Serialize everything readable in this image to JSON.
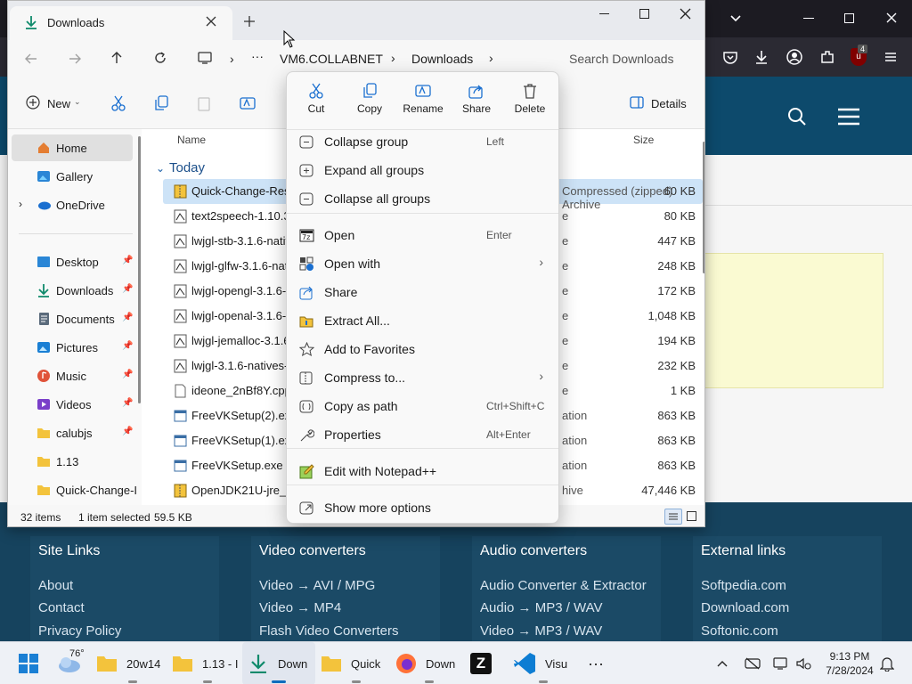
{
  "firefox": {
    "extension_badge": "4"
  },
  "site": {
    "footer": [
      {
        "heading": "Site Links",
        "links": [
          "About",
          "Contact",
          "Privacy Policy"
        ]
      },
      {
        "heading": "Video converters",
        "links": [
          "Video → AVI / MPG",
          "Video → MP4",
          "Flash Video Converters"
        ]
      },
      {
        "heading": "Audio converters",
        "links": [
          "Audio Converter & Extractor",
          "Audio → MP3 / WAV",
          "Video → MP3 / WAV"
        ]
      },
      {
        "heading": "External links",
        "links": [
          "Softpedia.com",
          "Download.com",
          "Softonic.com"
        ]
      }
    ]
  },
  "explorer": {
    "tab_title": "Downloads",
    "breadcrumb": [
      "VM6.COLLABNET",
      "Downloads"
    ],
    "search_placeholder": "Search Downloads",
    "toolbar": {
      "new_label": "New",
      "details_label": "Details"
    },
    "nav": {
      "home": "Home",
      "gallery": "Gallery",
      "onedrive": "OneDrive",
      "pinned": [
        "Desktop",
        "Downloads",
        "Documents",
        "Pictures",
        "Music",
        "Videos",
        "calubjs",
        "1.13",
        "Quick-Change-I"
      ]
    },
    "columns": {
      "name": "Name",
      "size": "Size"
    },
    "group": "Today",
    "files": [
      {
        "name": "Quick-Change-Resolu",
        "type": "Compressed (zipped) Archive",
        "size": "60 KB"
      },
      {
        "name": "text2speech-1.10.3-na",
        "type": "e",
        "size": "80 KB"
      },
      {
        "name": "lwjgl-stb-3.1.6-natives",
        "type": "e",
        "size": "447 KB"
      },
      {
        "name": "lwjgl-glfw-3.1.6-nativ",
        "type": "e",
        "size": "248 KB"
      },
      {
        "name": "lwjgl-opengl-3.1.6-na",
        "type": "e",
        "size": "172 KB"
      },
      {
        "name": "lwjgl-openal-3.1.6-nat",
        "type": "e",
        "size": "1,048 KB"
      },
      {
        "name": "lwjgl-jemalloc-3.1.6-n",
        "type": "e",
        "size": "194 KB"
      },
      {
        "name": "lwjgl-3.1.6-natives-wi",
        "type": "e",
        "size": "232 KB"
      },
      {
        "name": "ideone_2nBf8Y.cpp",
        "type": "e",
        "size": "1 KB"
      },
      {
        "name": "FreeVKSetup(2).exe",
        "type": "ation",
        "size": "863 KB"
      },
      {
        "name": "FreeVKSetup(1).exe",
        "type": "ation",
        "size": "863 KB"
      },
      {
        "name": "FreeVKSetup.exe",
        "type": "ation",
        "size": "863 KB"
      },
      {
        "name": "OpenJDK21U-jre_x64_",
        "type": "hive",
        "size": "47,446 KB"
      }
    ],
    "status": {
      "count": "32 items",
      "selected": "1 item selected",
      "size": "59.5 KB"
    }
  },
  "context_menu": {
    "top_actions": [
      "Cut",
      "Copy",
      "Rename",
      "Share",
      "Delete"
    ],
    "items": [
      {
        "label": "Collapse group",
        "shortcut": "Left"
      },
      {
        "label": "Expand all groups",
        "shortcut": ""
      },
      {
        "label": "Collapse all groups",
        "shortcut": ""
      },
      {
        "label": "Open",
        "shortcut": "Enter"
      },
      {
        "label": "Open with",
        "shortcut": ""
      },
      {
        "label": "Share",
        "shortcut": ""
      },
      {
        "label": "Extract All...",
        "shortcut": ""
      },
      {
        "label": "Add to Favorites",
        "shortcut": ""
      },
      {
        "label": "Compress to...",
        "shortcut": ""
      },
      {
        "label": "Copy as path",
        "shortcut": "Ctrl+Shift+C"
      },
      {
        "label": "Properties",
        "shortcut": "Alt+Enter"
      },
      {
        "label": "Edit with Notepad++",
        "shortcut": ""
      },
      {
        "label": "Show more options",
        "shortcut": ""
      }
    ]
  },
  "taskbar": {
    "weather": "76°",
    "apps": [
      "20w14",
      "1.13 - I",
      "Down",
      "Quick",
      "Down",
      "Visu"
    ],
    "time": "9:13 PM",
    "date": "7/28/2024"
  }
}
